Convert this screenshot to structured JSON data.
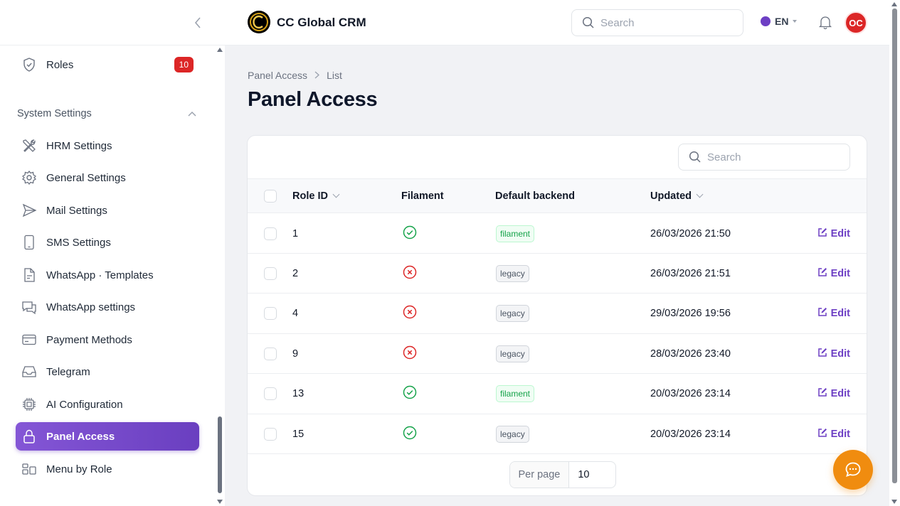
{
  "app": {
    "brand": "CC Global CRM",
    "avatar_initials": "OC",
    "language": "EN"
  },
  "topbar": {
    "search_placeholder": "Search"
  },
  "sidebar": {
    "roles": {
      "label": "Roles",
      "badge": "10"
    },
    "group_title": "System Settings",
    "items": [
      {
        "label": "HRM Settings",
        "icon": "tools-icon"
      },
      {
        "label": "General Settings",
        "icon": "gear-icon"
      },
      {
        "label": "Mail Settings",
        "icon": "send-icon"
      },
      {
        "label": "SMS Settings",
        "icon": "phone-icon"
      },
      {
        "label": "WhatsApp · Templates",
        "icon": "document-icon"
      },
      {
        "label": "WhatsApp settings",
        "icon": "chat-icon"
      },
      {
        "label": "Payment Methods",
        "icon": "credit-card-icon"
      },
      {
        "label": "Telegram",
        "icon": "inbox-icon"
      },
      {
        "label": "AI Configuration",
        "icon": "chip-icon"
      },
      {
        "label": "Panel Access",
        "icon": "lock-icon",
        "active": true
      },
      {
        "label": "Menu by Role",
        "icon": "layout-icon"
      }
    ]
  },
  "page": {
    "breadcrumb": [
      "Panel Access",
      "List"
    ],
    "title": "Panel Access"
  },
  "table": {
    "search_placeholder": "Search",
    "columns": {
      "role_id": "Role ID",
      "filament": "Filament",
      "default_backend": "Default backend",
      "updated": "Updated"
    },
    "edit_label": "Edit",
    "rows": [
      {
        "role_id": "1",
        "filament": true,
        "backend": "filament",
        "updated": "26/03/2026 21:50"
      },
      {
        "role_id": "2",
        "filament": false,
        "backend": "legacy",
        "updated": "26/03/2026 21:51"
      },
      {
        "role_id": "4",
        "filament": false,
        "backend": "legacy",
        "updated": "29/03/2026 19:56"
      },
      {
        "role_id": "9",
        "filament": false,
        "backend": "legacy",
        "updated": "28/03/2026 23:40"
      },
      {
        "role_id": "13",
        "filament": true,
        "backend": "filament",
        "updated": "20/03/2026 23:14"
      },
      {
        "role_id": "15",
        "filament": true,
        "backend": "legacy",
        "updated": "20/03/2026 23:14"
      }
    ],
    "per_page_label": "Per page",
    "per_page_value": "10"
  },
  "colors": {
    "accent": "#6d3fc4",
    "success": "#16a34a",
    "danger": "#dc2626",
    "fab": "#f08c0f"
  }
}
